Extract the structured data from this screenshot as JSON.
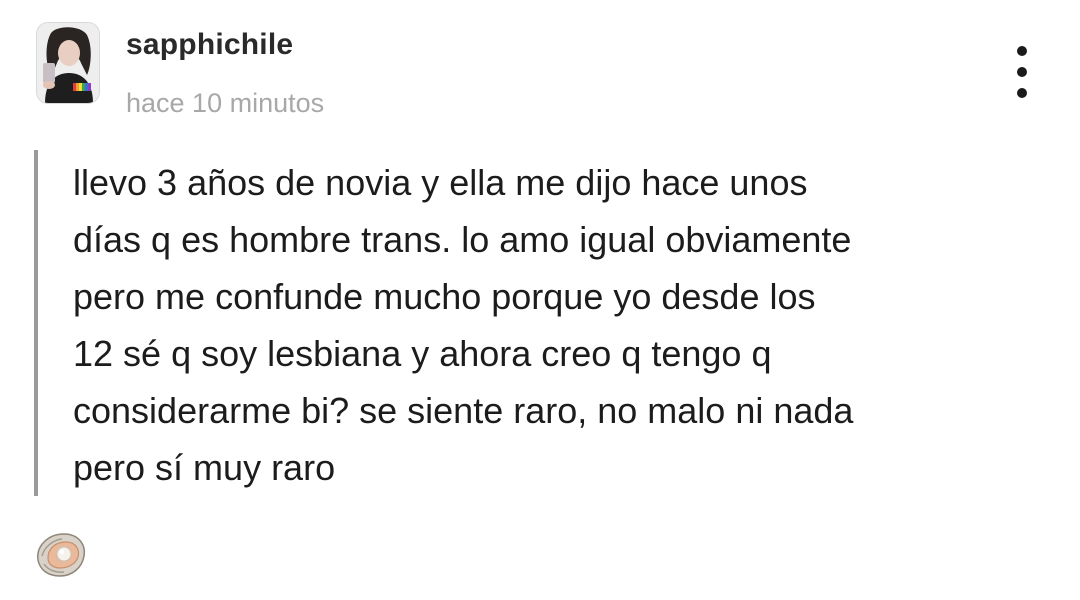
{
  "post": {
    "author": {
      "username": "sapphichile",
      "avatar_icon": "avatar-photo"
    },
    "timestamp": "hace 10 minutos",
    "menu_icon": "more-vertical-icon",
    "quote_bar_color": "#9a9a9a",
    "text_lines": [
      "llevo 3 años de novia y ella me dijo hace unos",
      "días q es hombre trans. lo amo igual obviamente",
      "pero me confunde mucho porque yo desde los",
      "12 sé q soy lesbiana y ahora creo q tengo q",
      "considerarme bi? se siente raro, no malo ni nada",
      "pero sí muy raro"
    ]
  },
  "reaction": {
    "icon": "oyster-emoji-icon"
  }
}
